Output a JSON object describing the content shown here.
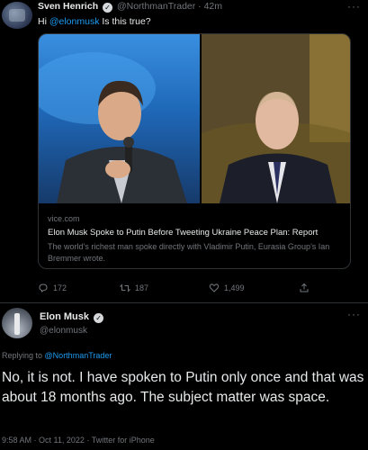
{
  "quoted_tweet": {
    "author_name": "Sven Henrich",
    "author_handle": "@NorthmanTrader",
    "time_sep": "·",
    "time": "42m",
    "text_prefix": "Hi",
    "text_mention": "@elonmusk",
    "text_suffix": "Is this true?",
    "link_card": {
      "domain": "vice.com",
      "title": "Elon Musk Spoke to Putin Before Tweeting Ukraine Peace Plan: Report",
      "description": "The world’s richest man spoke directly with Vladimir Putin, Eurasia Group’s Ian Bremmer wrote."
    },
    "actions": {
      "reply_count": "172",
      "retweet_count": "187",
      "like_count": "1,499"
    }
  },
  "main_tweet": {
    "author_name": "Elon Musk",
    "author_handle": "@elonmusk",
    "replying_prefix": "Replying to",
    "replying_to": "@NorthmanTrader",
    "text": "No, it is not. I have spoken to Putin only once and that was about 18 months ago. The subject matter was space.",
    "timestamp": "9:58 AM · Oct 11, 2022 · Twitter for iPhone"
  },
  "icons": [
    "reply-icon",
    "retweet-icon",
    "like-icon",
    "share-icon",
    "verified-badge-icon",
    "more-icon"
  ],
  "colors": {
    "background": "#000000",
    "text_primary": "#e7e9ea",
    "text_secondary": "#71767b",
    "accent": "#1d9bf0",
    "border": "#2f3336"
  }
}
